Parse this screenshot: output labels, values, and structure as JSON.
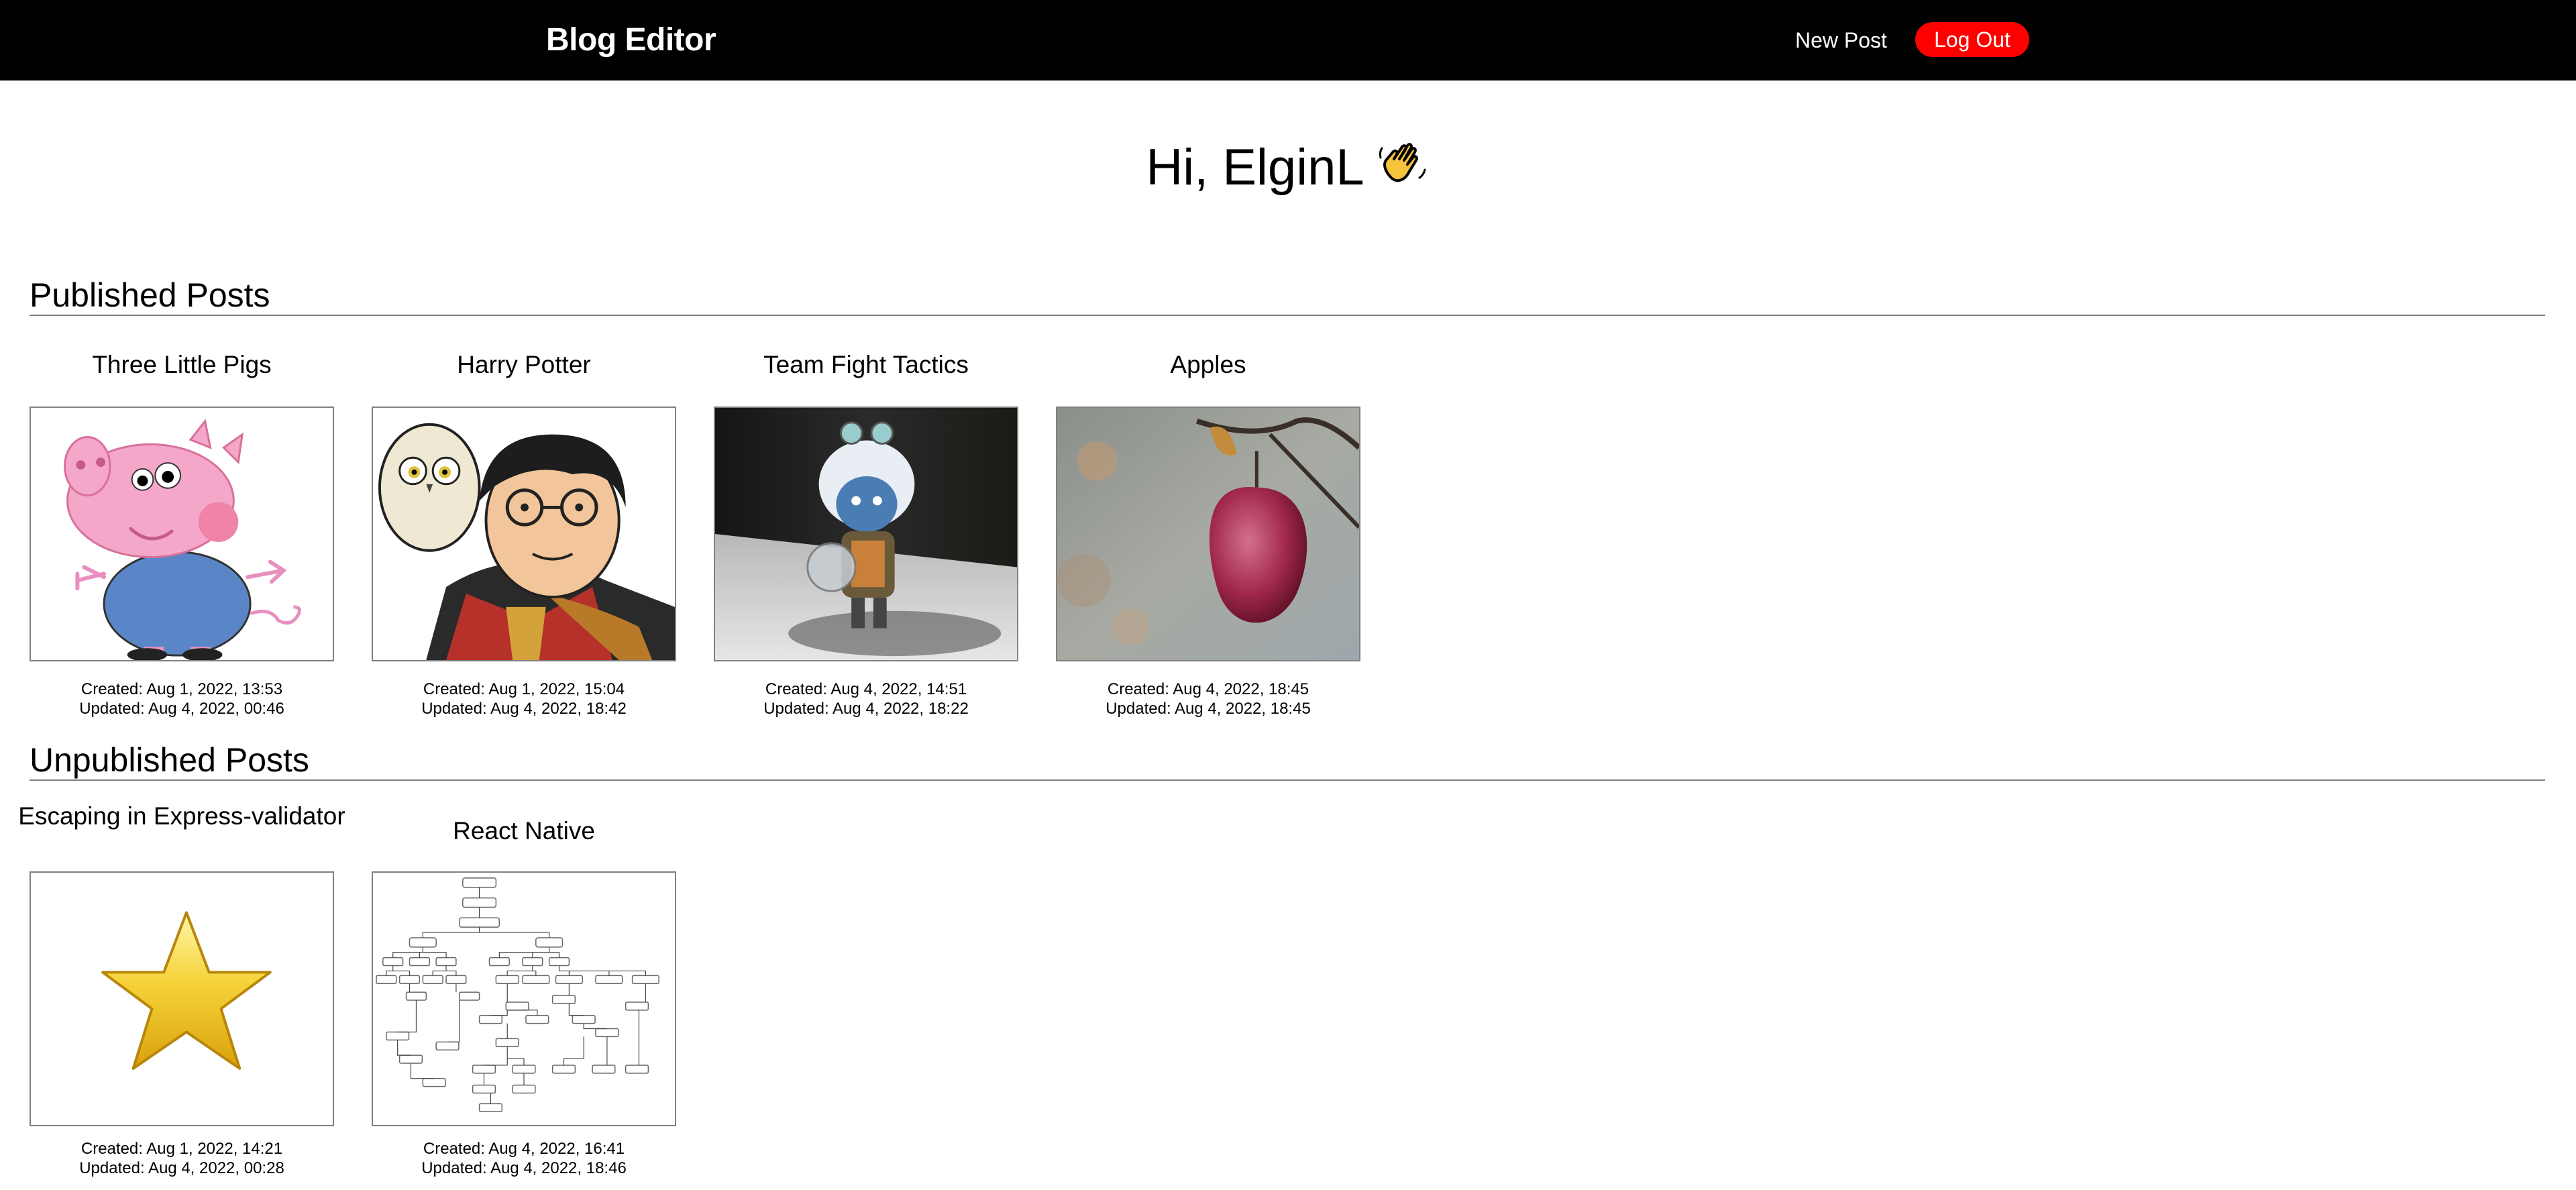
{
  "navbar": {
    "brand": "Blog Editor",
    "new_post_label": "New Post",
    "logout_label": "Log Out",
    "logout_color": "#ff0000"
  },
  "greeting": {
    "text": "Hi, ElginL",
    "emoji_icon": "waving-hand-icon"
  },
  "published": {
    "heading": "Published Posts",
    "posts": [
      {
        "title": "Three Little Pigs",
        "image_icon": "cartoon-pig-image",
        "created": "Created: Aug 1, 2022, 13:53",
        "updated": "Updated: Aug 4, 2022, 00:46"
      },
      {
        "title": "Harry Potter",
        "image_icon": "cartoon-wizard-owl-image",
        "created": "Created: Aug 1, 2022, 15:04",
        "updated": "Updated: Aug 4, 2022, 18:42"
      },
      {
        "title": "Team Fight Tactics",
        "image_icon": "figurine-photo-image",
        "created": "Created: Aug 4, 2022, 14:51",
        "updated": "Updated: Aug 4, 2022, 18:22"
      },
      {
        "title": "Apples",
        "image_icon": "red-apple-photo-image",
        "created": "Created: Aug 4, 2022, 18:45",
        "updated": "Updated: Aug 4, 2022, 18:45"
      }
    ]
  },
  "unpublished": {
    "heading": "Unpublished Posts",
    "posts": [
      {
        "title": "Escaping in Express-validator",
        "image_icon": "gold-star-image",
        "created": "Created: Aug 1, 2022, 14:21",
        "updated": "Updated: Aug 4, 2022, 00:28"
      },
      {
        "title": "React Native",
        "image_icon": "component-tree-diagram-image",
        "created": "Created: Aug 4, 2022, 16:41",
        "updated": "Updated: Aug 4, 2022, 18:46"
      }
    ]
  }
}
